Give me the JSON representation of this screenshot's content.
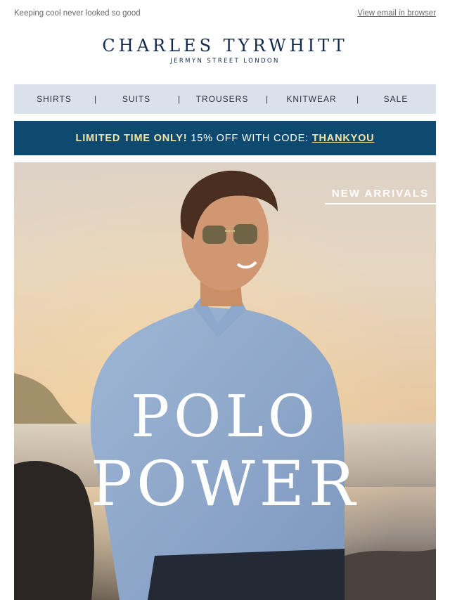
{
  "preheader": {
    "text": "Keeping cool never looked so good",
    "view_in_browser": "View email in browser"
  },
  "logo": {
    "main": "CHARLES TYRWHITT",
    "sub": "JERMYN STREET LONDON"
  },
  "nav": {
    "items": [
      "SHIRTS",
      "SUITS",
      "TROUSERS",
      "KNITWEAR",
      "SALE"
    ],
    "separator": "|"
  },
  "promo": {
    "highlight": "LIMITED TIME ONLY!",
    "text": "15% OFF WITH CODE:",
    "code": "THANKYOU"
  },
  "hero": {
    "badge": "NEW ARRIVALS",
    "title_line1": "POLO",
    "title_line2": "POWER"
  },
  "colors": {
    "navy": "#12294a",
    "nav_bg": "#d9e1ea",
    "promo_bg": "#0e4a70",
    "promo_accent": "#f3e3a3"
  }
}
